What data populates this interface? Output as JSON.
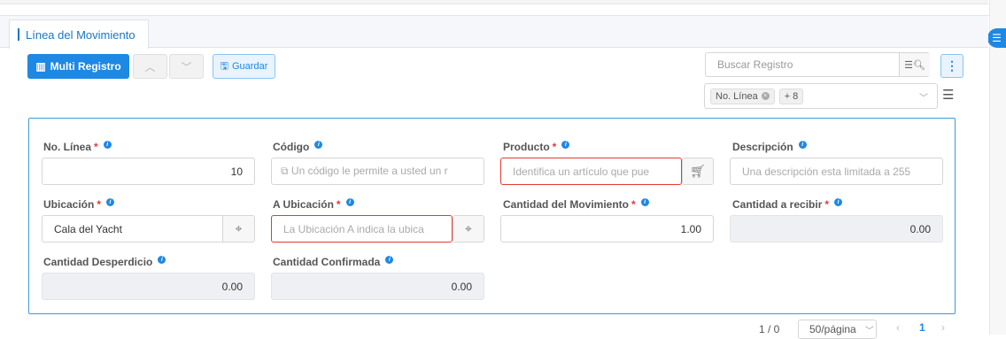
{
  "tab": {
    "label": "Línea del Movimiento"
  },
  "toolbar": {
    "multi_label": "Multi Registro",
    "save_label": "Guardar"
  },
  "search": {
    "placeholder": "Buscar Registro"
  },
  "filter": {
    "chip_label": "No. Línea",
    "more_label": "+ 8"
  },
  "form": {
    "linea": {
      "label": "No. Línea",
      "value": "10"
    },
    "codigo": {
      "label": "Código",
      "placeholder": "Un código le permite a usted un r"
    },
    "producto": {
      "label": "Producto",
      "placeholder": "Identifica un artículo que pue"
    },
    "descripcion": {
      "label": "Descripción",
      "placeholder": "Una descripción esta limitada a 255"
    },
    "ubicacion": {
      "label": "Ubicación",
      "value": "Cala del Yacht"
    },
    "a_ubicacion": {
      "label": "A Ubicación",
      "placeholder": "La Ubicación A indica la ubica"
    },
    "cantidad_mov": {
      "label": "Cantidad del Movimiento",
      "value": "1.00"
    },
    "cantidad_recibir": {
      "label": "Cantidad a recibir",
      "value": "0.00"
    },
    "cantidad_desp": {
      "label": "Cantidad Desperdicio",
      "value": "0.00"
    },
    "cantidad_conf": {
      "label": "Cantidad Confirmada",
      "value": "0.00"
    }
  },
  "pager": {
    "count": "1 / 0",
    "per_page": "50/página",
    "current_page": "1"
  },
  "colors": {
    "accent": "#1e88e5",
    "error": "#e53935",
    "form_border": "#3a9bd8"
  }
}
